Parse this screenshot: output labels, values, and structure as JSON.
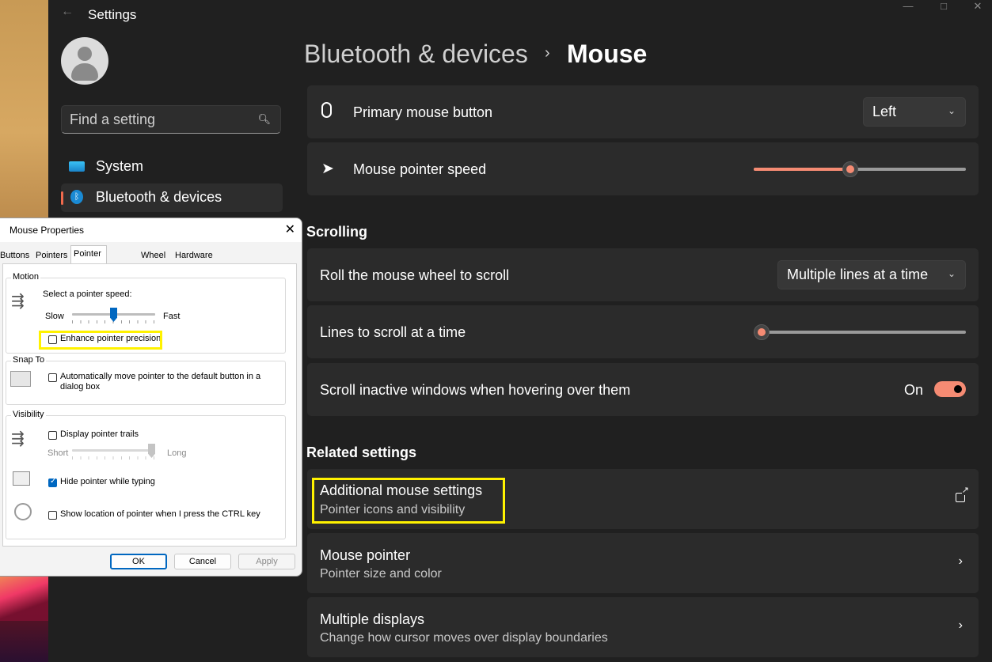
{
  "window": {
    "title": "Settings",
    "back_glyph": "←",
    "minimize_glyph": "—",
    "maximize_glyph": "□",
    "close_glyph": "✕"
  },
  "sidebar": {
    "search_placeholder": "Find a setting",
    "search_icon": "search-icon",
    "items": [
      {
        "label": "System",
        "icon": "monitor-icon",
        "active": false
      },
      {
        "label": "Bluetooth & devices",
        "icon": "bluetooth-icon",
        "active": true
      }
    ]
  },
  "breadcrumb": {
    "parent": "Bluetooth & devices",
    "separator": "›",
    "current": "Mouse"
  },
  "mouse": {
    "primary_button": {
      "label": "Primary mouse button",
      "value": "Left",
      "icon": "mouse-icon"
    },
    "pointer_speed": {
      "label": "Mouse pointer speed",
      "value": 0.45,
      "icon": "pointer-icon"
    }
  },
  "scrolling": {
    "heading": "Scrolling",
    "roll_wheel": {
      "label": "Roll the mouse wheel to scroll",
      "value": "Multiple lines at a time"
    },
    "lines_to_scroll": {
      "label": "Lines to scroll at a time",
      "value": 0.0
    },
    "scroll_inactive": {
      "label": "Scroll inactive windows when hovering over them",
      "state": "On",
      "enabled": true
    }
  },
  "related": {
    "heading": "Related settings",
    "items": [
      {
        "title": "Additional mouse settings",
        "subtitle": "Pointer icons and visibility",
        "icon": "external-link-icon"
      },
      {
        "title": "Mouse pointer",
        "subtitle": "Pointer size and color",
        "icon": "chevron-right-icon"
      },
      {
        "title": "Multiple displays",
        "subtitle": "Change how cursor moves over display boundaries",
        "icon": "chevron-right-icon"
      }
    ]
  },
  "dialog": {
    "title": "Mouse Properties",
    "close_glyph": "✕",
    "tabs": [
      "Buttons",
      "Pointers",
      "Pointer Options",
      "Wheel",
      "Hardware"
    ],
    "active_tab": "Pointer Options",
    "motion": {
      "group": "Motion",
      "speed_label": "Select a pointer speed:",
      "slow": "Slow",
      "fast": "Fast",
      "speed_value": 0.5,
      "enhance_precision": {
        "label": "Enhance pointer precision",
        "checked": false
      }
    },
    "snap_to": {
      "group": "Snap To",
      "auto_move": {
        "label_line1": "Automatically move pointer to the default button in a",
        "label_line2": "dialog box",
        "checked": false
      }
    },
    "visibility": {
      "group": "Visibility",
      "trails": {
        "label": "Display pointer trails",
        "checked": false,
        "short": "Short",
        "long": "Long",
        "value": 1.0
      },
      "hide_typing": {
        "label": "Hide pointer while typing",
        "checked": true
      },
      "show_location": {
        "label": "Show location of pointer when I press the CTRL key",
        "checked": false
      }
    },
    "buttons": {
      "ok": "OK",
      "cancel": "Cancel",
      "apply": "Apply"
    }
  },
  "colors": {
    "accent": "#f58b73",
    "highlight": "#fff200",
    "background": "#202020",
    "card": "#2b2b2b"
  }
}
